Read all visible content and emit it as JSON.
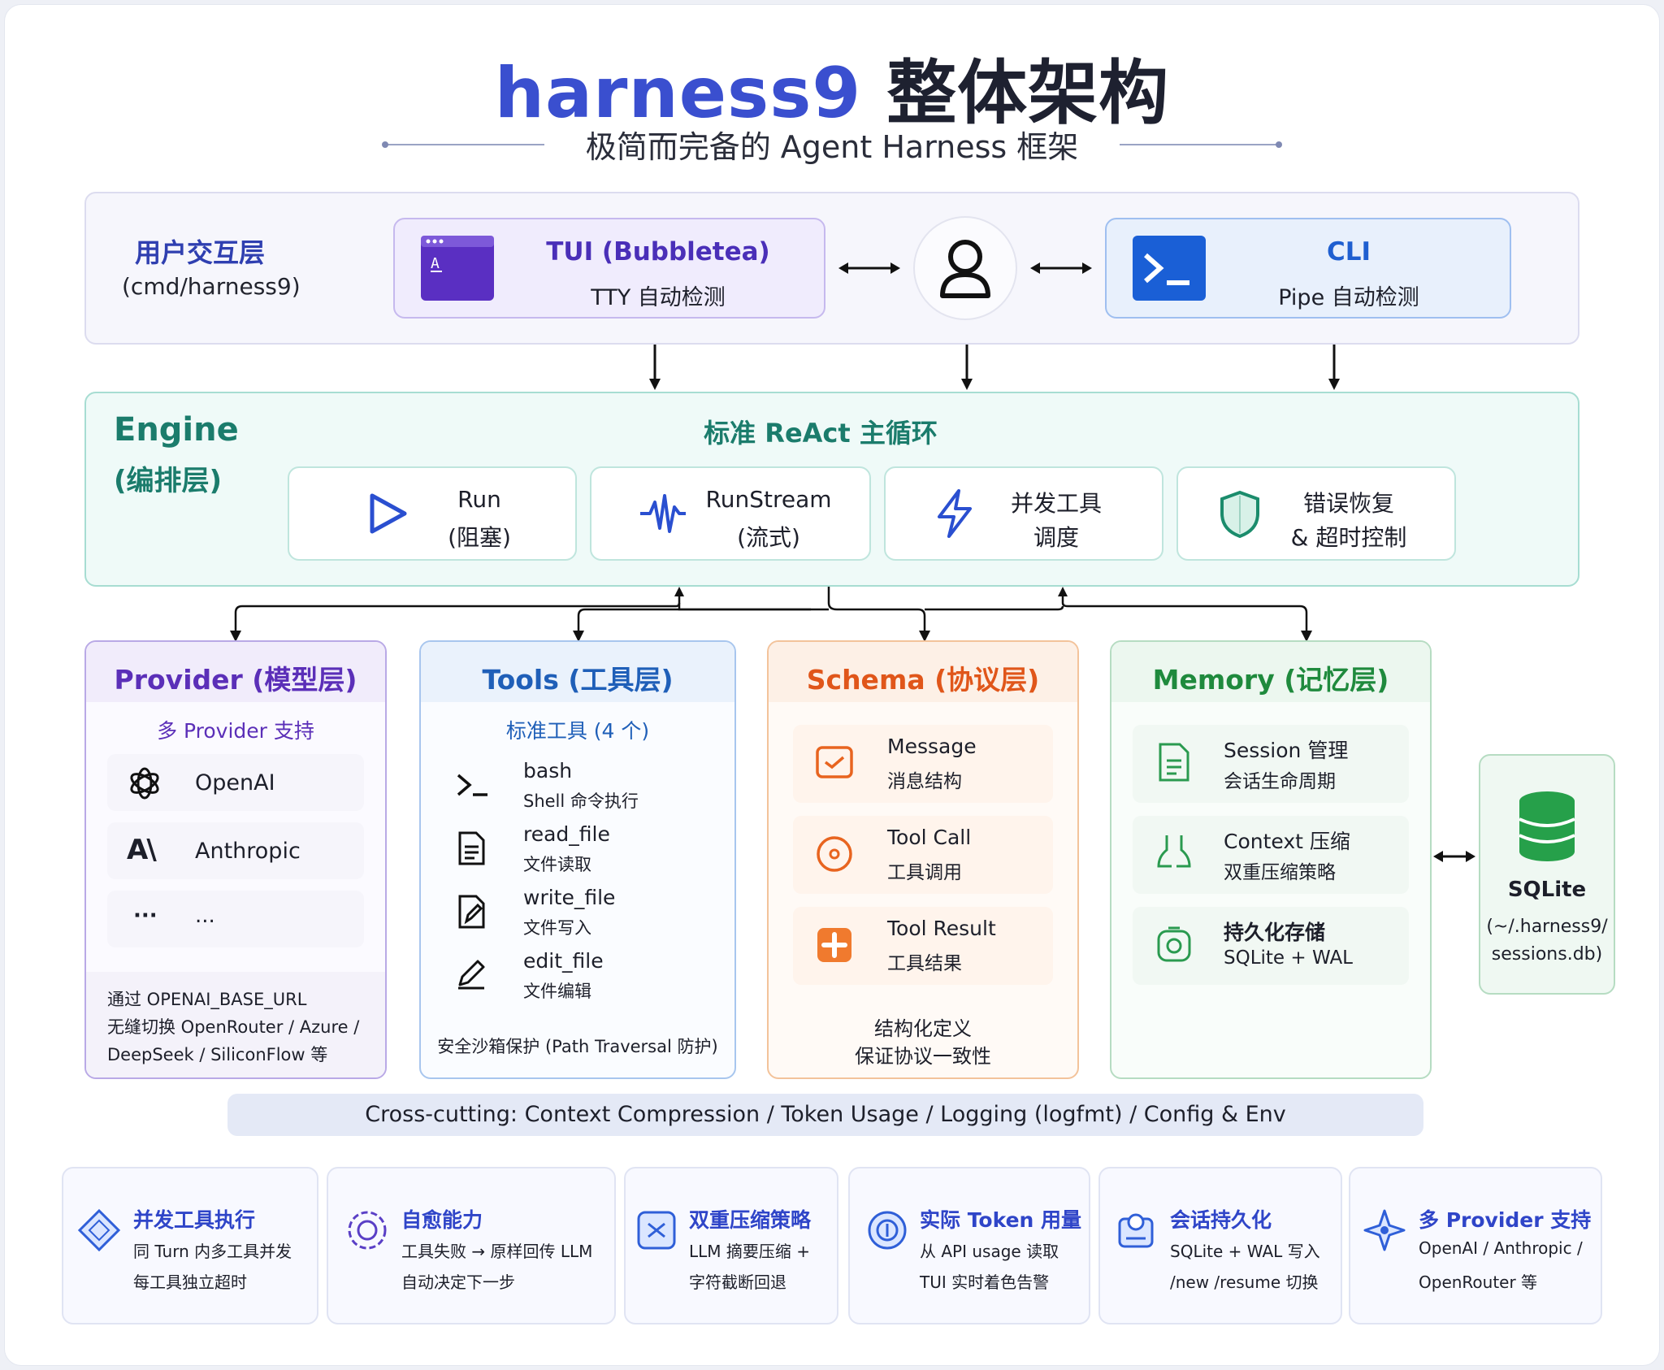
{
  "title": {
    "brand": "harness9",
    "rest": "整体架构"
  },
  "subtitle": "极简而完备的 Agent Harness 框架",
  "user_layer": {
    "name": "用户交互层",
    "path": "(cmd/harness9)",
    "tui": {
      "title": "TUI (Bubbletea)",
      "sub": "TTY 自动检测"
    },
    "cli": {
      "title": "CLI",
      "sub": "Pipe 自动检测"
    }
  },
  "engine": {
    "name": "Engine",
    "sub": "(编排层)",
    "loop_title": "标准 ReAct 主循环",
    "items": [
      {
        "l1": "Run",
        "l2": "(阻塞)",
        "icon": "play-icon"
      },
      {
        "l1": "RunStream",
        "l2": "(流式)",
        "icon": "waveform-icon"
      },
      {
        "l1": "并发工具",
        "l2": "调度",
        "icon": "lightning-icon"
      },
      {
        "l1": "错误恢复",
        "l2": "& 超时控制",
        "icon": "shield-icon"
      }
    ]
  },
  "provider": {
    "title": "Provider (模型层)",
    "subtitle": "多 Provider 支持",
    "items": [
      {
        "name": "OpenAI",
        "icon": "openai-icon"
      },
      {
        "name": "Anthropic",
        "icon": "anthropic-icon"
      },
      {
        "mark": "···",
        "name": "..."
      }
    ],
    "note": [
      "通过 OPENAI_BASE_URL",
      "无缝切换 OpenRouter / Azure /",
      "DeepSeek / SiliconFlow 等"
    ],
    "colors": {
      "border": "#b9a9e6",
      "title": "#5b2fb8",
      "header_bg": "#f1ecfb"
    }
  },
  "tools": {
    "title": "Tools (工具层)",
    "subtitle": "标准工具 (4 个)",
    "items": [
      {
        "name": "bash",
        "desc": "Shell 命令执行",
        "icon": "terminal-icon"
      },
      {
        "name": "read_file",
        "desc": "文件读取",
        "icon": "document-icon"
      },
      {
        "name": "write_file",
        "desc": "文件写入",
        "icon": "edit-document-icon"
      },
      {
        "name": "edit_file",
        "desc": "文件编辑",
        "icon": "pencil-icon"
      }
    ],
    "note": "安全沙箱保护 (Path Traversal 防护)",
    "colors": {
      "border": "#a8c6ee",
      "title": "#1f5fb8",
      "header_bg": "#eaf2fc"
    }
  },
  "schema": {
    "title": "Schema (协议层)",
    "items": [
      {
        "name": "Message",
        "desc": "消息结构",
        "icon": "message-icon"
      },
      {
        "name": "Tool Call",
        "desc": "工具调用",
        "icon": "target-icon"
      },
      {
        "name": "Tool Result",
        "desc": "工具结果",
        "icon": "puzzle-icon"
      }
    ],
    "note": [
      "结构化定义",
      "保证协议一致性"
    ],
    "colors": {
      "border": "#f3c39b",
      "title": "#e0561a",
      "header_bg": "#fdf0e6"
    }
  },
  "memory": {
    "title": "Memory (记忆层)",
    "items": [
      {
        "name": "Session 管理",
        "desc": "会话生命周期",
        "icon": "session-icon"
      },
      {
        "name": "Context 压缩",
        "desc": "双重压缩策略",
        "icon": "compress-icon"
      },
      {
        "name": "持久化存储",
        "desc": "SQLite + WAL",
        "icon": "storage-icon"
      }
    ],
    "colors": {
      "border": "#b6dcc2",
      "title": "#1f8a3d",
      "header_bg": "#ecf7ef"
    }
  },
  "sqlite": {
    "name": "SQLite",
    "path1": "(~/.harness9/",
    "path2": "sessions.db)"
  },
  "cross_cutting": "Cross-cutting: Context Compression / Token Usage / Logging (logfmt) / Config & Env",
  "features": [
    {
      "title": "并发工具执行",
      "l1": "同 Turn 内多工具并发",
      "l2": "每工具独立超时",
      "icon": "diamond-icon"
    },
    {
      "title": "自愈能力",
      "l1": "工具失败 → 原样回传 LLM",
      "l2": "自动决定下一步",
      "icon": "heal-icon"
    },
    {
      "title": "双重压缩策略",
      "l1": "LLM 摘要压缩 +",
      "l2": "字符截断回退",
      "icon": "compress-box-icon"
    },
    {
      "title": "实际 Token 用量",
      "l1": "从 API usage 读取",
      "l2": "TUI 实时着色告警",
      "icon": "token-icon"
    },
    {
      "title": "会话持久化",
      "l1": "SQLite + WAL 写入",
      "l2": "/new /resume 切换",
      "icon": "persist-icon"
    },
    {
      "title": "多 Provider 支持",
      "l1": "OpenAI / Anthropic /",
      "l2": "OpenRouter 等",
      "icon": "network-icon"
    }
  ],
  "colors": {
    "accent": "#3a4fcf",
    "engine": "#1b7c6c",
    "feature_title": "#2f45c8"
  }
}
